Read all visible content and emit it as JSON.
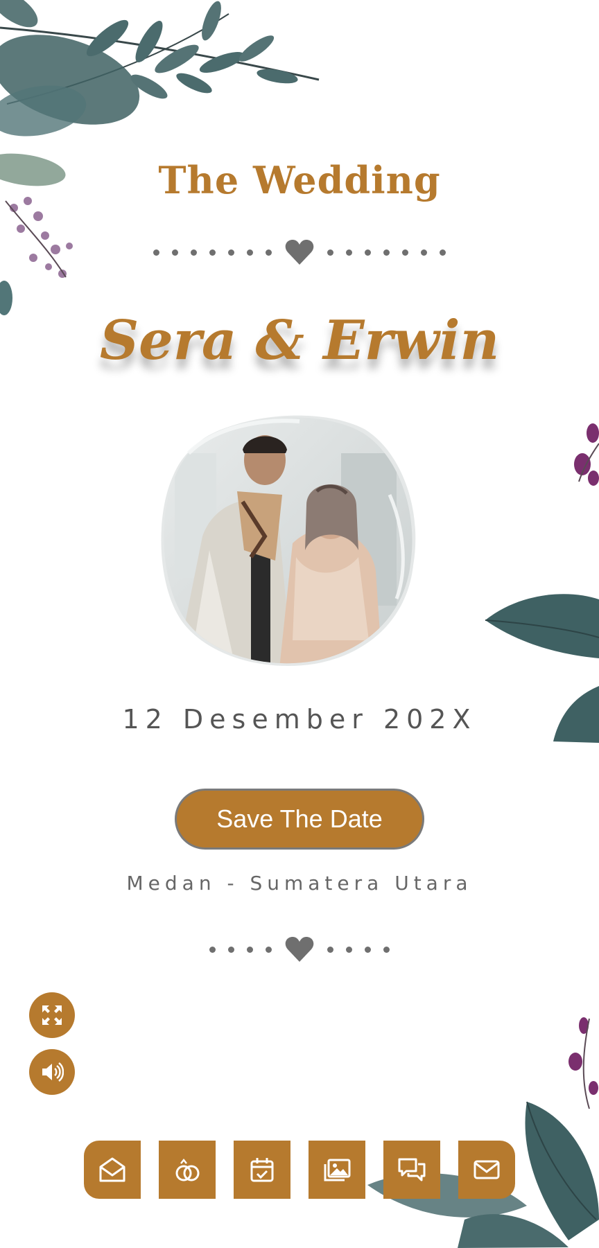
{
  "header": {
    "title": "The Wedding"
  },
  "couple": {
    "names": "Sera & Erwin",
    "photo": "couple-photo"
  },
  "event": {
    "date": "12 Desember 202X",
    "save_label": "Save The Date",
    "location": "Medan - Sumatera Utara"
  },
  "colors": {
    "accent": "#b67a2e",
    "dots": "#6f6f6f",
    "leaf": "#3f6163",
    "flower": "#8a3c78"
  },
  "floating_controls": [
    {
      "icon": "fullscreen-icon"
    },
    {
      "icon": "volume-icon"
    }
  ],
  "bottom_nav": [
    {
      "icon": "envelope-open-icon"
    },
    {
      "icon": "rings-icon"
    },
    {
      "icon": "calendar-check-icon"
    },
    {
      "icon": "images-icon"
    },
    {
      "icon": "chat-icon"
    },
    {
      "icon": "mail-icon"
    }
  ]
}
